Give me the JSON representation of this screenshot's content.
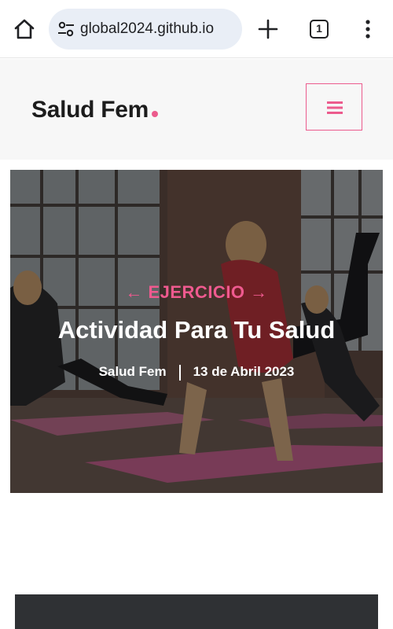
{
  "browser": {
    "url": "global2024.github.io",
    "tab_count": "1"
  },
  "site": {
    "logo": "Salud Fem",
    "accent": "#ec5b8d"
  },
  "hero": {
    "category": "← EJERCICIO →",
    "title": "Actividad Para Tu Salud",
    "author": "Salud Fem",
    "date": "13 de Abril 2023"
  },
  "icons": {
    "home": "home-icon",
    "site_settings": "tune-icon",
    "new_tab": "plus-icon",
    "tab_switcher": "tabs-icon",
    "more": "kebab-menu-icon",
    "menu": "hamburger-icon"
  }
}
